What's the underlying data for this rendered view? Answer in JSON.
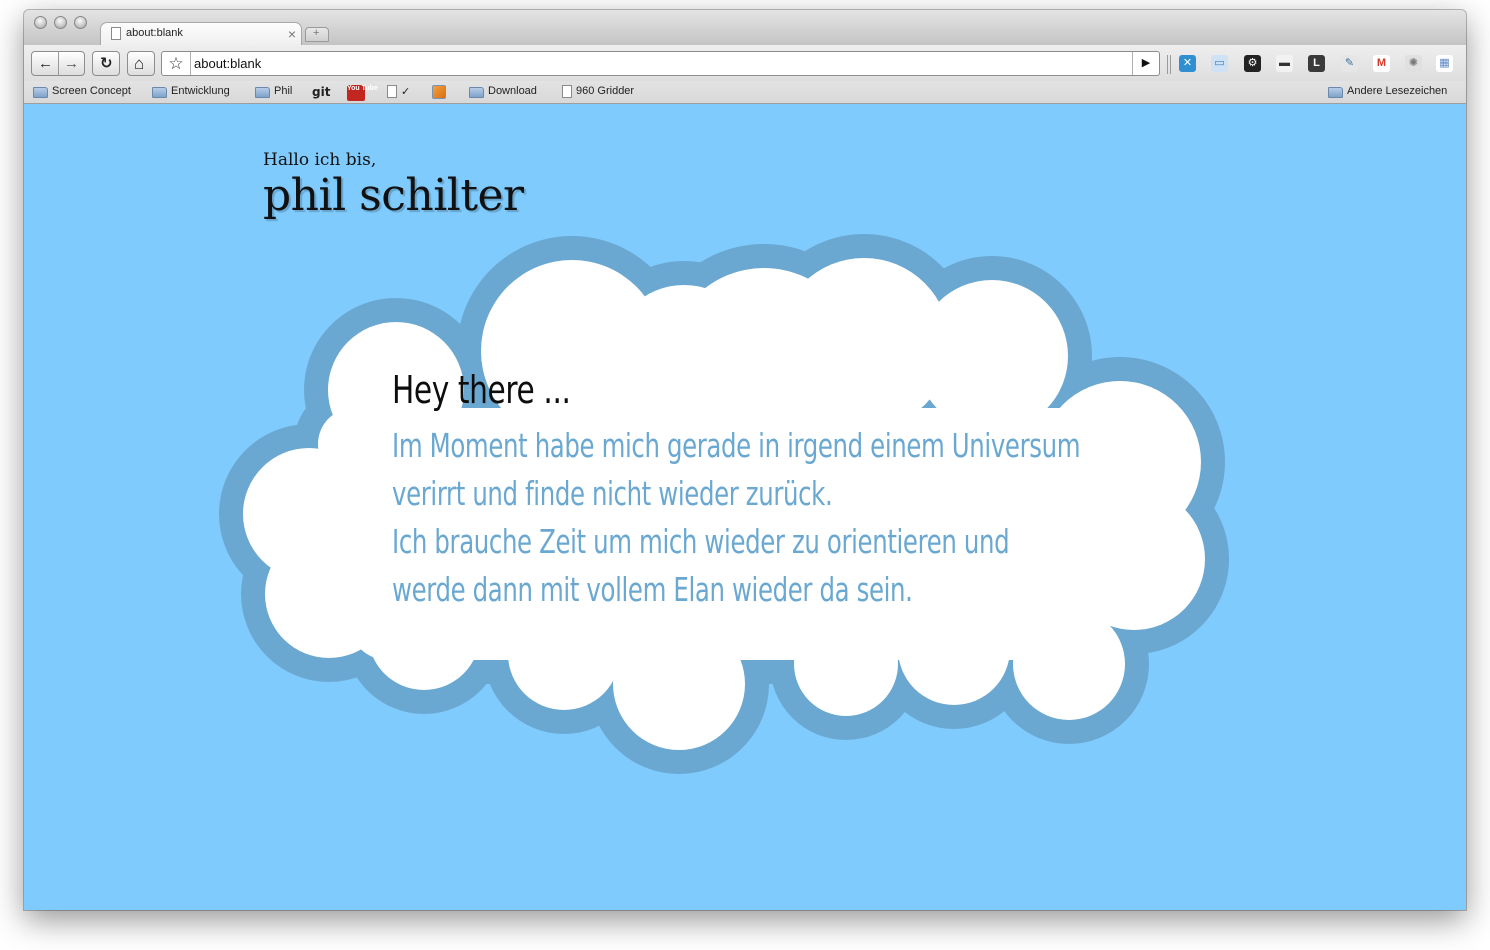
{
  "browser": {
    "tab": {
      "title": "about:blank",
      "close": "×"
    },
    "newtab": "+",
    "nav": {
      "back": "←",
      "forward": "→",
      "reload": "↻",
      "home": "⌂"
    },
    "omnibox": {
      "star": "☆",
      "url": "about:blank",
      "go": "▶"
    },
    "extensions": [
      {
        "icon": "x-extension-icon",
        "glyph": "✕",
        "bg": "#2f8fd1",
        "fg": "#ffffff"
      },
      {
        "icon": "window-extension-icon",
        "glyph": "▭",
        "bg": "#cfe2f5",
        "fg": "#3d7cb8"
      },
      {
        "icon": "gear-extension-icon",
        "glyph": "⚙",
        "bg": "#222222",
        "fg": "#ffffff"
      },
      {
        "icon": "ruler-extension-icon",
        "glyph": "▬",
        "bg": "#f2f2f2",
        "fg": "#333333"
      },
      {
        "icon": "l-extension-icon",
        "glyph": "L",
        "bg": "#3a3a3a",
        "fg": "#ffffff"
      },
      {
        "icon": "eyedropper-extension-icon",
        "glyph": "✎",
        "bg": "#e6e6e6",
        "fg": "#3b6f99"
      },
      {
        "icon": "gmail-extension-icon",
        "glyph": "M",
        "bg": "#ffffff",
        "fg": "#d23b2f"
      },
      {
        "icon": "settings-extension-icon",
        "glyph": "✺",
        "bg": "#e0e0e0",
        "fg": "#777777"
      },
      {
        "icon": "calendar-extension-icon",
        "glyph": "▦",
        "bg": "#ffffff",
        "fg": "#5b86c3"
      }
    ]
  },
  "bookmarks": {
    "items": [
      {
        "type": "folder",
        "label": "Screen Concept"
      },
      {
        "type": "folder",
        "label": "Entwicklung"
      },
      {
        "type": "folder",
        "label": "Phil"
      },
      {
        "type": "git",
        "label": "",
        "glyph": "git"
      },
      {
        "type": "youtube",
        "label": "",
        "glyph": "You Tube"
      },
      {
        "type": "page",
        "label": "✓"
      },
      {
        "type": "rss",
        "label": ""
      },
      {
        "type": "folder",
        "label": "Download"
      },
      {
        "type": "page",
        "label": "960 Gridder"
      }
    ],
    "other": "Andere Lesezeichen"
  },
  "page": {
    "greeting": "Hallo ich bis,",
    "name": "phil schilter",
    "cloud_heading": "Hey there ...",
    "cloud_paragraphs": [
      "Im Moment habe mich gerade in irgend einem Universum verirrt und finde nicht wieder zurück.",
      "Ich brauche Zeit um mich wieder zu orientieren und werde dann mit vollem Elan wieder da sein."
    ]
  },
  "colors": {
    "page_background": "#7fcbfd",
    "cloud_border": "#6aa8d1",
    "cloud_fill": "#ffffff",
    "message_text": "#6aa8d1"
  }
}
